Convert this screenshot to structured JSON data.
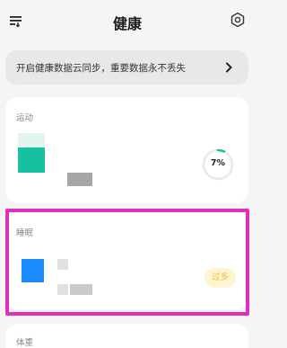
{
  "header": {
    "title": "健康",
    "menu_icon": "menu-sort-icon",
    "settings_icon": "gear-icon"
  },
  "sync_banner": {
    "text": "开启健康数据云同步，重要数据永不丢失",
    "chevron_icon": "chevron-right-icon"
  },
  "cards": {
    "exercise": {
      "label": "运动",
      "progress_text": "7%",
      "progress_value": 0.07,
      "accent_color": "#17c1a0"
    },
    "sleep": {
      "label": "睡眠",
      "status": "过多",
      "accent_color": "#1a8cff",
      "status_color": "#e8bd36"
    },
    "weight": {
      "label": "体重"
    }
  },
  "highlight_color": "#e02fbf"
}
